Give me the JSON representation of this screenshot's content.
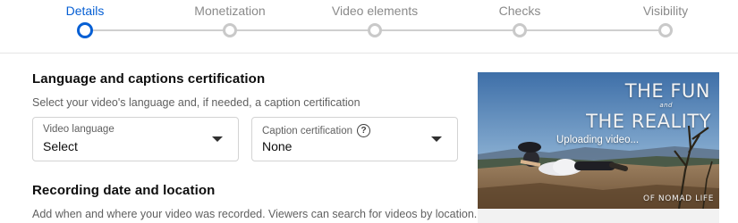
{
  "stepper": {
    "steps": [
      {
        "label": "Details",
        "active": true
      },
      {
        "label": "Monetization",
        "active": false
      },
      {
        "label": "Video elements",
        "active": false
      },
      {
        "label": "Checks",
        "active": false
      },
      {
        "label": "Visibility",
        "active": false
      }
    ]
  },
  "language_section": {
    "title": "Language and captions certification",
    "description": "Select your video's language and, if needed, a caption certification",
    "video_language": {
      "label": "Video language",
      "value": "Select"
    },
    "caption_certification": {
      "label": "Caption certification",
      "value": "None",
      "help_icon": "help-circle-icon"
    }
  },
  "recording_section": {
    "title": "Recording date and location",
    "description": "Add when and where your video was recorded. Viewers can search for videos by location."
  },
  "preview": {
    "thumbnail_title_line1": "THE FUN",
    "thumbnail_title_and": "and",
    "thumbnail_title_line2": "THE REALITY",
    "thumbnail_footer": "OF NOMAD LIFE",
    "status": "Uploading video..."
  },
  "colors": {
    "accent": "#065fd4",
    "inactive": "#c9c9c9"
  }
}
